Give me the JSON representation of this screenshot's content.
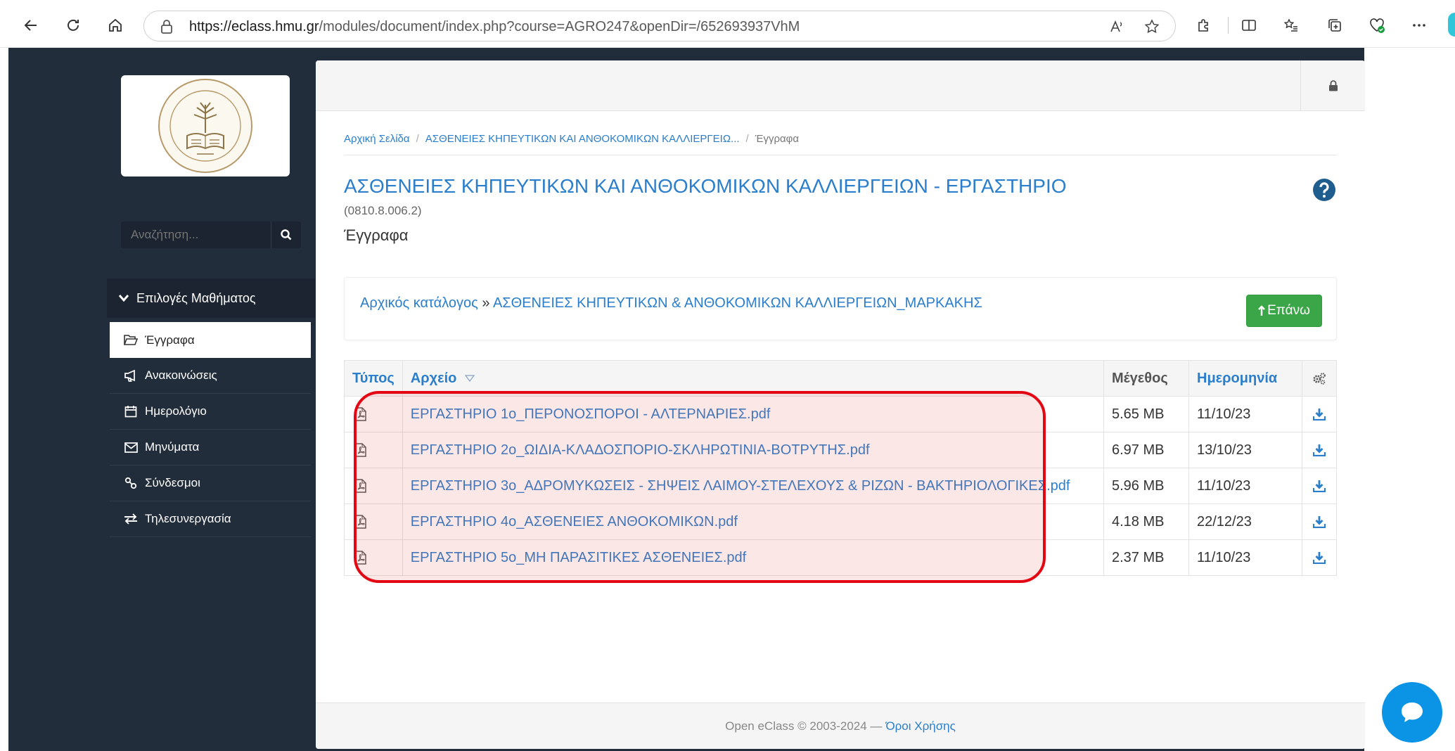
{
  "browser": {
    "url_host": "https://eclass.hmu.gr",
    "url_path": "/modules/document/index.php?course=AGRO247&openDir=/652693937VhM"
  },
  "sidebar": {
    "search_placeholder": "Αναζήτηση...",
    "menu_heading": "Επιλογές Μαθήματος",
    "items": [
      {
        "label": "Έγγραφα",
        "icon": "folder-open-icon",
        "active": true
      },
      {
        "label": "Ανακοινώσεις",
        "icon": "bullhorn-icon"
      },
      {
        "label": "Ημερολόγιο",
        "icon": "calendar-icon"
      },
      {
        "label": "Μηνύματα",
        "icon": "envelope-icon"
      },
      {
        "label": "Σύνδεσμοι",
        "icon": "link-icon"
      },
      {
        "label": "Τηλεσυνεργασία",
        "icon": "exchange-icon"
      }
    ]
  },
  "breadcrumb": {
    "home": "Αρχική Σελίδα",
    "course": "ΑΣΘΕΝΕΙΕΣ ΚΗΠΕΥΤΙΚΩΝ ΚΑΙ ΑΝΘΟΚΟΜΙΚΩΝ ΚΑΛΛΙΕΡΓΕΙΩ...",
    "current": "Έγγραφα"
  },
  "course": {
    "title": "ΑΣΘΕΝΕΙΕΣ ΚΗΠΕΥΤΙΚΩΝ ΚΑΙ ΑΝΘΟΚΟΜΙΚΩΝ ΚΑΛΛΙΕΡΓΕΙΩΝ - ΕΡΓΑΣΤΗΡΙΟ",
    "code": "(0810.8.006.2)",
    "section": "Έγγραφα"
  },
  "directory": {
    "root_label": "Αρχικός κατάλογος",
    "separator": "»",
    "current": "ΑΣΘΕΝΕΙΕΣ ΚΗΠΕΥΤΙΚΩΝ & ΑΝΘΟΚΟΜΙΚΩΝ ΚΑΛΛΙΕΡΓΕΙΩΝ_ΜΑΡΚΑΚΗΣ",
    "up_button": "Επάνω"
  },
  "table": {
    "headers": {
      "type": "Τύπος",
      "file": "Αρχείο",
      "size": "Μέγεθος",
      "date": "Ημερομηνία"
    },
    "rows": [
      {
        "name": "ΕΡΓΑΣΤΗΡΙΟ 1ο_ΠΕΡΟΝΟΣΠΟΡΟΙ - ΑΛΤΕΡΝΑΡΙΕΣ.pdf",
        "size": "5.65 MB",
        "date": "11/10/23"
      },
      {
        "name": "ΕΡΓΑΣΤΗΡΙΟ 2ο_ΩΙΔΙΑ-ΚΛΑΔΟΣΠΟΡΙΟ-ΣΚΛΗΡΩΤΙΝΙΑ-ΒΟΤΡΥΤΗΣ.pdf",
        "size": "6.97 MB",
        "date": "13/10/23"
      },
      {
        "name": "ΕΡΓΑΣΤΗΡΙΟ 3ο_ΑΔΡΟΜΥΚΩΣΕΙΣ - ΣΗΨΕΙΣ ΛΑΙΜΟΥ-ΣΤΕΛΕΧΟΥΣ & ΡΙΖΩΝ - ΒΑΚΤΗΡΙΟΛΟΓΙΚΕΣ.pdf",
        "size": "5.96 MB",
        "date": "11/10/23"
      },
      {
        "name": "ΕΡΓΑΣΤΗΡΙΟ 4ο_ΑΣΘΕΝΕΙΕΣ ΑΝΘΟΚΟΜΙΚΩΝ.pdf",
        "size": "4.18 MB",
        "date": "22/12/23"
      },
      {
        "name": "ΕΡΓΑΣΤΗΡΙΟ 5ο_ΜΗ ΠΑΡΑΣΙΤΙΚΕΣ ΑΣΘΕΝΕΙΕΣ.pdf",
        "size": "2.37 MB",
        "date": "11/10/23"
      }
    ]
  },
  "footer": {
    "copyright": "Open eClass © 2003-2024 —",
    "terms": "Όροι Χρήσης"
  },
  "colors": {
    "sidebar_bg": "#222d3b",
    "link": "#2a7ecb",
    "up_button": "#3aa647",
    "highlight": "#e30613",
    "chat": "#0b93e6"
  }
}
